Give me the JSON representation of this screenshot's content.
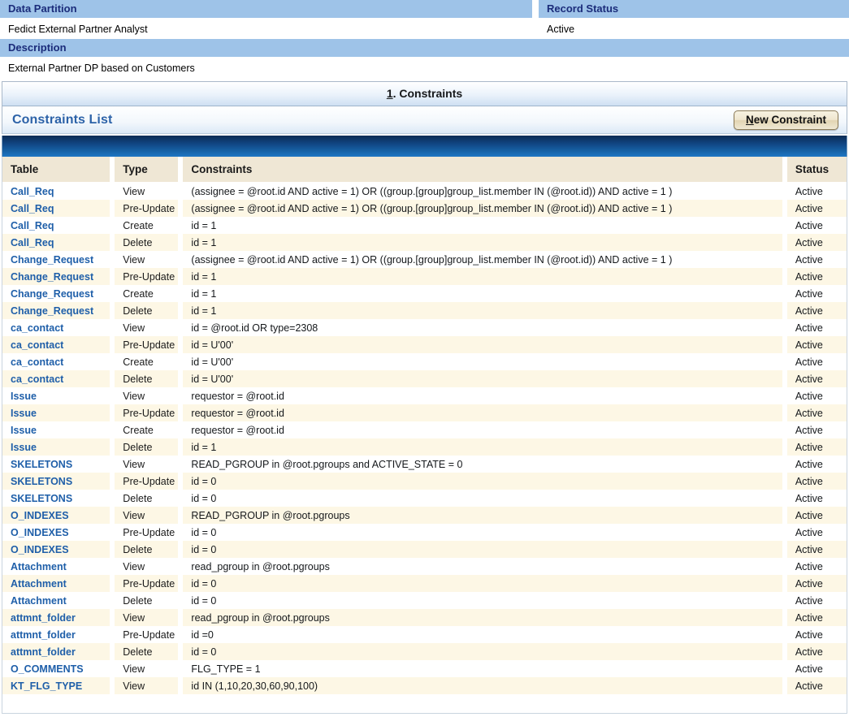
{
  "summary": {
    "data_partition_label": "Data Partition",
    "data_partition_value": "Fedict External Partner Analyst",
    "record_status_label": "Record Status",
    "record_status_value": "Active",
    "description_label": "Description",
    "description_value": "External Partner DP based on Customers"
  },
  "section": {
    "tab_number": "1",
    "tab_suffix": ". Constraints",
    "list_title": "Constraints List",
    "new_button_accesskey": "N",
    "new_button_rest": "ew Constraint"
  },
  "grid": {
    "columns": [
      "Table",
      "Type",
      "Constraints",
      "Status"
    ],
    "rows": [
      {
        "table": "Call_Req",
        "type": "View",
        "constraint": "(assignee = @root.id AND active = 1) OR ((group.[group]group_list.member IN (@root.id)) AND active = 1 )",
        "status": "Active"
      },
      {
        "table": "Call_Req",
        "type": "Pre-Update",
        "constraint": "(assignee = @root.id AND active = 1) OR ((group.[group]group_list.member IN (@root.id)) AND active = 1 )",
        "status": "Active"
      },
      {
        "table": "Call_Req",
        "type": "Create",
        "constraint": "id = 1",
        "status": "Active"
      },
      {
        "table": "Call_Req",
        "type": "Delete",
        "constraint": "id = 1",
        "status": "Active"
      },
      {
        "table": "Change_Request",
        "type": "View",
        "constraint": "(assignee = @root.id AND active = 1) OR ((group.[group]group_list.member IN (@root.id)) AND active = 1 )",
        "status": "Active"
      },
      {
        "table": "Change_Request",
        "type": "Pre-Update",
        "constraint": "id = 1",
        "status": "Active"
      },
      {
        "table": "Change_Request",
        "type": "Create",
        "constraint": "id = 1",
        "status": "Active"
      },
      {
        "table": "Change_Request",
        "type": "Delete",
        "constraint": "id = 1",
        "status": "Active"
      },
      {
        "table": "ca_contact",
        "type": "View",
        "constraint": "id = @root.id OR type=2308",
        "status": "Active"
      },
      {
        "table": "ca_contact",
        "type": "Pre-Update",
        "constraint": "id = U'00'",
        "status": "Active"
      },
      {
        "table": "ca_contact",
        "type": "Create",
        "constraint": "id = U'00'",
        "status": "Active"
      },
      {
        "table": "ca_contact",
        "type": "Delete",
        "constraint": "id = U'00'",
        "status": "Active"
      },
      {
        "table": "Issue",
        "type": "View",
        "constraint": "requestor = @root.id",
        "status": "Active"
      },
      {
        "table": "Issue",
        "type": "Pre-Update",
        "constraint": "requestor = @root.id",
        "status": "Active"
      },
      {
        "table": "Issue",
        "type": "Create",
        "constraint": "requestor = @root.id",
        "status": "Active"
      },
      {
        "table": "Issue",
        "type": "Delete",
        "constraint": "id = 1",
        "status": "Active"
      },
      {
        "table": "SKELETONS",
        "type": "View",
        "constraint": "READ_PGROUP in @root.pgroups and ACTIVE_STATE = 0",
        "status": "Active"
      },
      {
        "table": "SKELETONS",
        "type": "Pre-Update",
        "constraint": "id = 0",
        "status": "Active"
      },
      {
        "table": "SKELETONS",
        "type": "Delete",
        "constraint": "id = 0",
        "status": "Active"
      },
      {
        "table": "O_INDEXES",
        "type": "View",
        "constraint": "READ_PGROUP in @root.pgroups",
        "status": "Active"
      },
      {
        "table": "O_INDEXES",
        "type": "Pre-Update",
        "constraint": "id = 0",
        "status": "Active"
      },
      {
        "table": "O_INDEXES",
        "type": "Delete",
        "constraint": "id = 0",
        "status": "Active"
      },
      {
        "table": "Attachment",
        "type": "View",
        "constraint": "read_pgroup in @root.pgroups",
        "status": "Active"
      },
      {
        "table": "Attachment",
        "type": "Pre-Update",
        "constraint": "id = 0",
        "status": "Active"
      },
      {
        "table": "Attachment",
        "type": "Delete",
        "constraint": "id = 0",
        "status": "Active"
      },
      {
        "table": "attmnt_folder",
        "type": "View",
        "constraint": "read_pgroup in @root.pgroups",
        "status": "Active"
      },
      {
        "table": "attmnt_folder",
        "type": "Pre-Update",
        "constraint": "id =0",
        "status": "Active"
      },
      {
        "table": "attmnt_folder",
        "type": "Delete",
        "constraint": "id = 0",
        "status": "Active"
      },
      {
        "table": "O_COMMENTS",
        "type": "View",
        "constraint": "FLG_TYPE = 1",
        "status": "Active"
      },
      {
        "table": "KT_FLG_TYPE",
        "type": "View",
        "constraint": "id IN (1,10,20,30,60,90,100)",
        "status": "Active"
      }
    ]
  },
  "colors": {
    "band_bg": "#9EC3E8",
    "band_text": "#1B2C7A",
    "list_title": "#2C62A8",
    "link": "#1F5FA9",
    "row_alt": "#FDF7E5",
    "header_cell": "#EFE7D5",
    "blue_bar_top": "#0B2C55",
    "blue_bar_bottom": "#1E77C4"
  }
}
